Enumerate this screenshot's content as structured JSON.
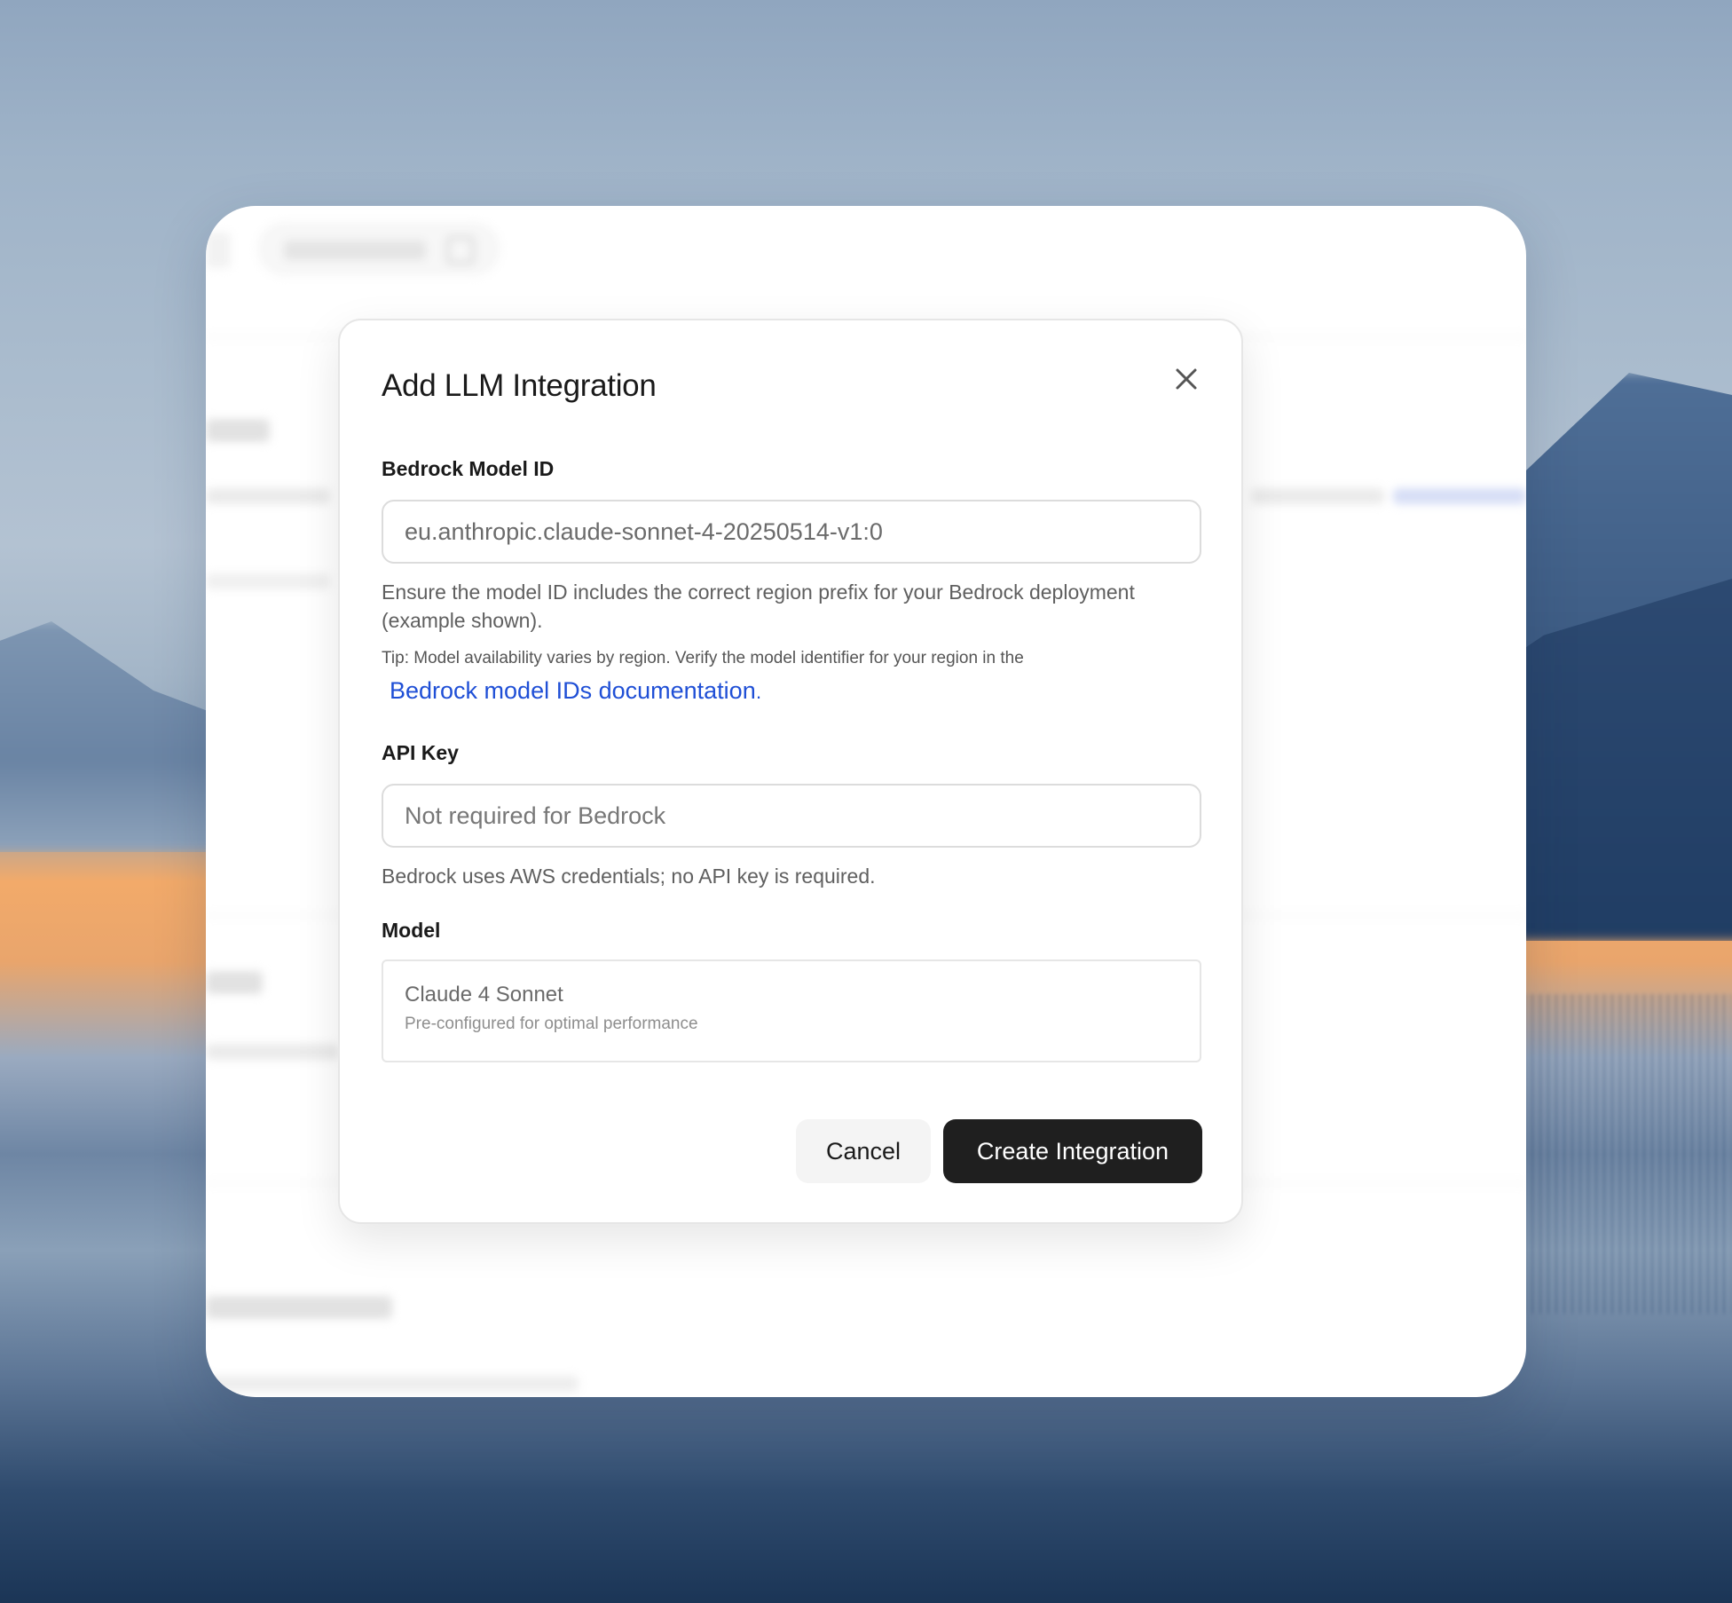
{
  "dialog": {
    "title": "Add LLM Integration",
    "close_icon": "close-icon",
    "model_id": {
      "label": "Bedrock Model ID",
      "value": "eu.anthropic.claude-sonnet-4-20250514-v1:0",
      "help": "Ensure the model ID includes the correct region prefix for your Bedrock deployment (example shown).",
      "tip": "Tip: Model availability varies by region. Verify the model identifier for your region in the",
      "link_text": "Bedrock model IDs documentation",
      "link_suffix": "."
    },
    "api_key": {
      "label": "API Key",
      "placeholder": "Not required for Bedrock",
      "help": "Bedrock uses AWS credentials; no API key is required."
    },
    "model": {
      "label": "Model",
      "name": "Claude 4 Sonnet",
      "description": "Pre-configured for optimal performance"
    },
    "buttons": {
      "cancel": "Cancel",
      "create": "Create Integration"
    }
  },
  "colors": {
    "primary_button": "#1f1f1f",
    "link": "#1f4fd6"
  }
}
